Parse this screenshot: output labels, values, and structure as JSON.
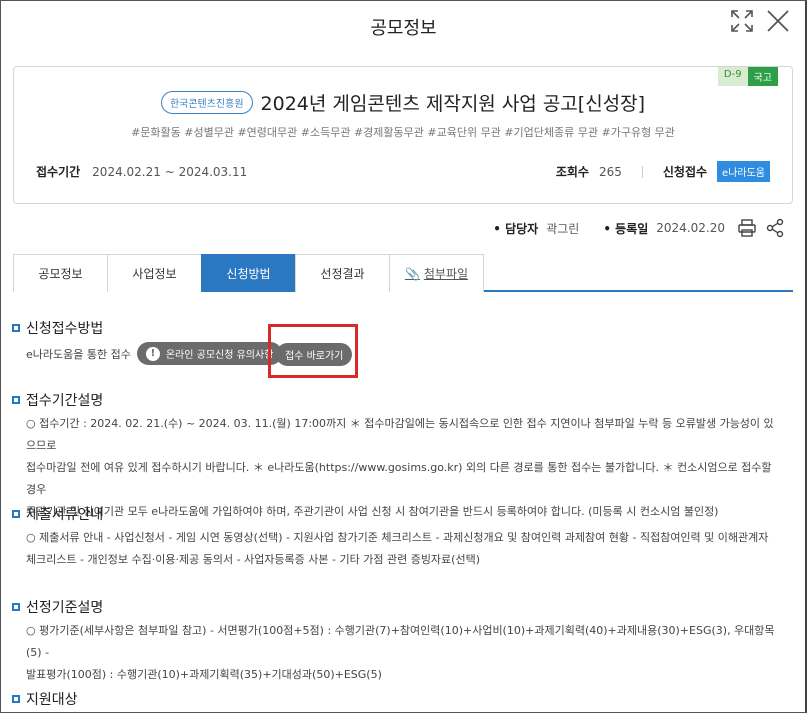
{
  "modal": {
    "title": "공모정보"
  },
  "badges": {
    "dday": "D-9",
    "scope": "국고"
  },
  "header": {
    "org": "한국콘텐츠진흥원",
    "title": "2024년 게임콘텐츠 제작지원 사업 공고[신성장]",
    "tags": "#문화활동 #성별무관 #연령대무관 #소득무관 #경제활동무관 #교육단위 무관 #기업단체종류 무관 #가구유형 무관"
  },
  "meta": {
    "period_label": "접수기간",
    "period_value": "2024.02.21 ~ 2024.03.11",
    "views_label": "조회수",
    "views_value": "265",
    "apply_label": "신청접수",
    "apply_badge": "e나라도움"
  },
  "info": {
    "manager_label": "• 담당자",
    "manager_value": "곽그린",
    "reg_label": "• 등록일",
    "reg_value": "2024.02.20"
  },
  "tabs": [
    {
      "label": "공모정보"
    },
    {
      "label": "사업정보"
    },
    {
      "label": "신청방법"
    },
    {
      "label": "선정결과"
    },
    {
      "label": "첨부파일"
    }
  ],
  "sections": {
    "s1_title": "신청접수방법",
    "s1_text": "e나라도움을 통한 접수",
    "s1_notice_btn": "온라인 공모신청 유의사항",
    "s1_go_btn": "접수 바로가기",
    "s2_title": "접수기간설명",
    "s2_line1": "○ 접수기간 : 2024. 02. 21.(수) ~ 2024. 03. 11.(월) 17:00까지 ＊ 접수마감일에는 동시접속으로 인한 접수 지연이나 첨부파일 누락 등 오류발생 가능성이 있으므로",
    "s2_line2": "접수마감일 전에 여유 있게 접수하시기 바랍니다. ＊ e나라도움(https://www.gosims.go.kr) 외의 다른 경로를 통한 접수는 불가합니다. ＊ 컨소시엄으로 접수할 경우",
    "s2_line3": "주관기관 및 참여기관 모두 e나라도움에 가입하여야 하며, 주관기관이 사업 신청 시 참여기관을 반드시 등록하여야 합니다. (미등록 시 컨소시엄 불인정)",
    "s3_title": "제출서류안내",
    "s3_line1": "○ 제출서류 안내 - 사업신청서 - 게임 시연 동영상(선택) - 지원사업 참가기준 체크리스트 - 과제신청개요 및 참여인력 과제참여 현황 - 직접참여인력 및 이해관계자",
    "s3_line2": "체크리스트 - 개인정보 수집·이용·제공 동의서 - 사업자등록증 사본 - 기타 가점 관련 증빙자료(선택)",
    "s4_title": "선정기준설명",
    "s4_line1": "○ 평가기준(세부사항은 첨부파일 참고) - 서면평가(100점+5점) : 수행기관(7)+참여인력(10)+사업비(10)+과제기획력(40)+과제내용(30)+ESG(3), 우대항목(5) -",
    "s4_line2": "발표평가(100점) : 수행기관(10)+과제기획력(35)+기대성과(50)+ESG(5)",
    "s5_title": "지원대상"
  }
}
